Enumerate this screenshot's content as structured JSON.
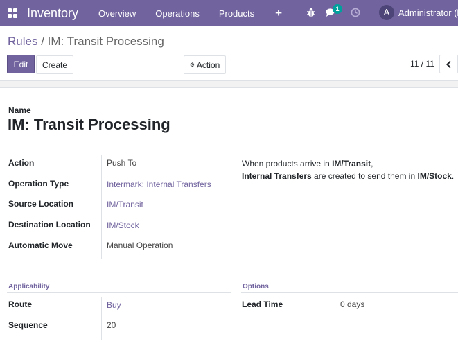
{
  "navbar": {
    "app_title": "Inventory",
    "menu": [
      "Overview",
      "Operations",
      "Products"
    ],
    "plus": "+",
    "chat_badge": "1",
    "avatar_letter": "A",
    "user_name": "Administrator (bs",
    "color": "#71639e"
  },
  "breadcrumb": {
    "parent": "Rules",
    "separator": "/",
    "current": "IM: Transit Processing"
  },
  "toolbar": {
    "edit_label": "Edit",
    "create_label": "Create",
    "action_label": "Action",
    "pager": "11 / 11"
  },
  "form": {
    "name_label": "Name",
    "title": "IM: Transit Processing",
    "fields": [
      {
        "label": "Action",
        "value": "Push To"
      },
      {
        "label": "Operation Type",
        "value": "Intermark: Internal Transfers"
      },
      {
        "label": "Source Location",
        "value": "IM/Transit"
      },
      {
        "label": "Destination Location",
        "value": "IM/Stock"
      },
      {
        "label": "Automatic Move",
        "value": "Manual Operation"
      }
    ],
    "note": {
      "p1": "When products arrive in ",
      "b1": "IM/Transit",
      "p2": ",",
      "b2": "Internal Transfers",
      "p3": " are created to send them in ",
      "b3": "IM/Stock",
      "p4": "."
    },
    "applicability": {
      "title": "Applicability",
      "route_label": "Route",
      "route_value": "Buy",
      "sequence_label": "Sequence",
      "sequence_value": "20"
    },
    "options": {
      "title": "Options",
      "lead_time_label": "Lead Time",
      "lead_time_value": "0 days"
    }
  }
}
